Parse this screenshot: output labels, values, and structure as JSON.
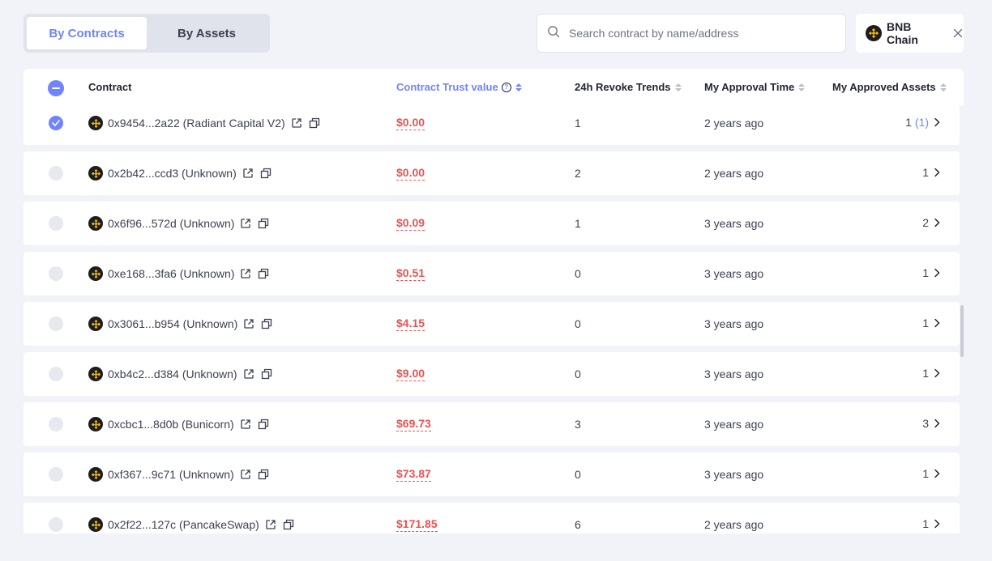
{
  "tabs": [
    {
      "label": "By Contracts",
      "active": true
    },
    {
      "label": "By Assets",
      "active": false
    }
  ],
  "search": {
    "placeholder": "Search contract by name/address",
    "value": ""
  },
  "chain": {
    "name": "BNB Chain",
    "icon": "bnb-logo-icon"
  },
  "table": {
    "columns": {
      "contract": "Contract",
      "trust": "Contract Trust value",
      "trend": "24h Revoke Trends",
      "time": "My Approval Time",
      "assets": "My Approved Assets"
    },
    "rows": [
      {
        "address": "0x9454...2a22 (Radiant Capital V2)",
        "trust": "$0.00",
        "trend": "1",
        "time": "2 years ago",
        "assets": "1",
        "assets_extra": "(1)",
        "checked": true
      },
      {
        "address": "0x2b42...ccd3 (Unknown)",
        "trust": "$0.00",
        "trend": "2",
        "time": "2 years ago",
        "assets": "1",
        "assets_extra": "",
        "checked": false
      },
      {
        "address": "0x6f96...572d (Unknown)",
        "trust": "$0.09",
        "trend": "1",
        "time": "3 years ago",
        "assets": "2",
        "assets_extra": "",
        "checked": false
      },
      {
        "address": "0xe168...3fa6 (Unknown)",
        "trust": "$0.51",
        "trend": "0",
        "time": "3 years ago",
        "assets": "1",
        "assets_extra": "",
        "checked": false
      },
      {
        "address": "0x3061...b954 (Unknown)",
        "trust": "$4.15",
        "trend": "0",
        "time": "3 years ago",
        "assets": "1",
        "assets_extra": "",
        "checked": false
      },
      {
        "address": "0xb4c2...d384 (Unknown)",
        "trust": "$9.00",
        "trend": "0",
        "time": "3 years ago",
        "assets": "1",
        "assets_extra": "",
        "checked": false
      },
      {
        "address": "0xcbc1...8d0b (Bunicorn)",
        "trust": "$69.73",
        "trend": "3",
        "time": "3 years ago",
        "assets": "3",
        "assets_extra": "",
        "checked": false
      },
      {
        "address": "0xf367...9c71 (Unknown)",
        "trust": "$73.87",
        "trend": "0",
        "time": "3 years ago",
        "assets": "1",
        "assets_extra": "",
        "checked": false
      },
      {
        "address": "0x2f22...127c (PancakeSwap)",
        "trust": "$171.85",
        "trend": "6",
        "time": "2 years ago",
        "assets": "1",
        "assets_extra": "",
        "checked": false
      }
    ]
  },
  "colors": {
    "accent": "#7084ff",
    "danger": "#ec5151",
    "background": "#f2f3f8"
  }
}
